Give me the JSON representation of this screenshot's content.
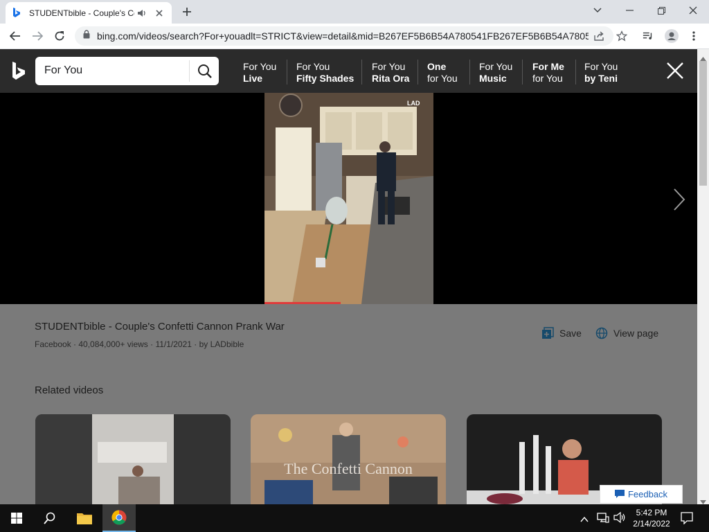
{
  "browser": {
    "tab_title": "STUDENTbible - Couple's Confetti Cannon Prank War",
    "url": "bing.com/videos/search?For+youadlt=STRICT&view=detail&mid=B267EF5B6B54A780541FB267EF5B6B54A7805..."
  },
  "bing": {
    "search_query": "For You",
    "related_searches": [
      {
        "line1": "For You",
        "line2": "Live"
      },
      {
        "line1": "For You",
        "line2": "Fifty Shades"
      },
      {
        "line1": "For You",
        "line2": "Rita Ora"
      },
      {
        "line1": "One",
        "line2": "for You"
      },
      {
        "line1": "For You",
        "line2": "Music"
      },
      {
        "line1": "For Me",
        "line2": "for You"
      },
      {
        "line1": "For You",
        "line2": "by Teni"
      }
    ]
  },
  "video": {
    "watermark": "LAD",
    "title": "STUDENTbible - Couple's Confetti Cannon Prank War",
    "source": "Facebook",
    "views": "40,084,000+ views",
    "date": "11/1/2021",
    "author": "by LADbible",
    "progress_fraction": 0.45,
    "save_label": "Save",
    "view_page_label": "View page"
  },
  "related": {
    "heading": "Related videos",
    "card2_overlay_text": "The Confetti Cannon"
  },
  "feedback_label": "Feedback",
  "taskbar": {
    "time": "5:42 PM",
    "date": "2/14/2022"
  },
  "colors": {
    "bing_header": "#2b2b2b",
    "details_bg": "#7a7a7a",
    "progress_red": "#e03a3a",
    "feedback_blue": "#1a5fb4"
  }
}
